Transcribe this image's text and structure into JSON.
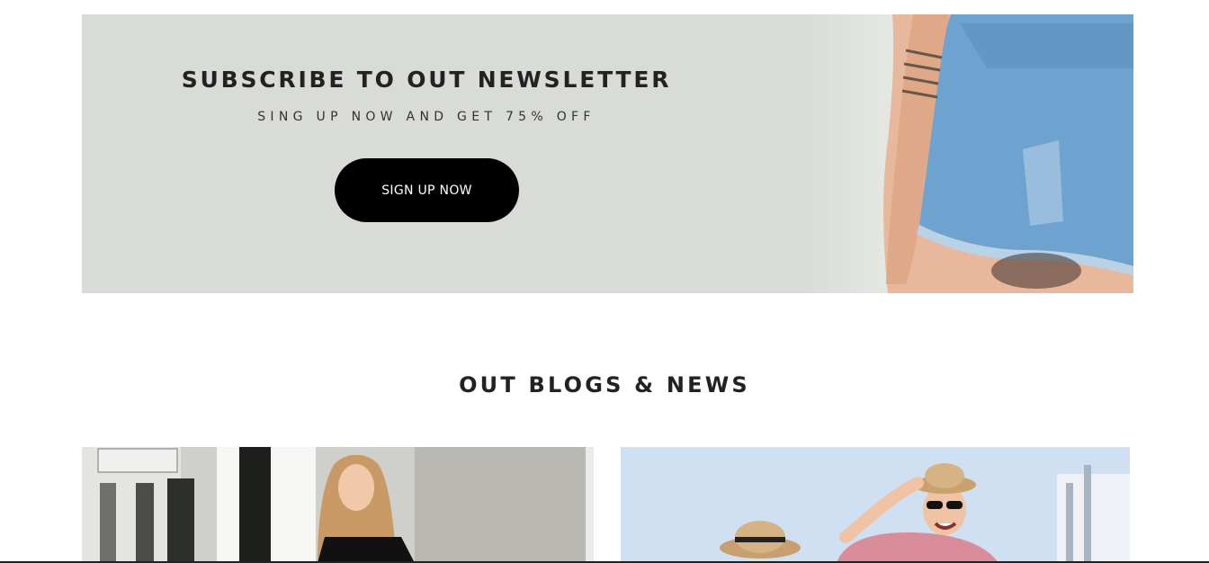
{
  "newsletter": {
    "title": "SUBSCRIBE TO OUT NEWSLETTER",
    "subtitle": "SING UP NOW AND GET 75% OFF",
    "button_label": "SIGN UP NOW"
  },
  "blogs": {
    "title": "OUT BLOGS & NEWS"
  },
  "colors": {
    "banner_bg": "#d9dbd6",
    "button_bg": "#000000",
    "text_dark": "#222222"
  }
}
